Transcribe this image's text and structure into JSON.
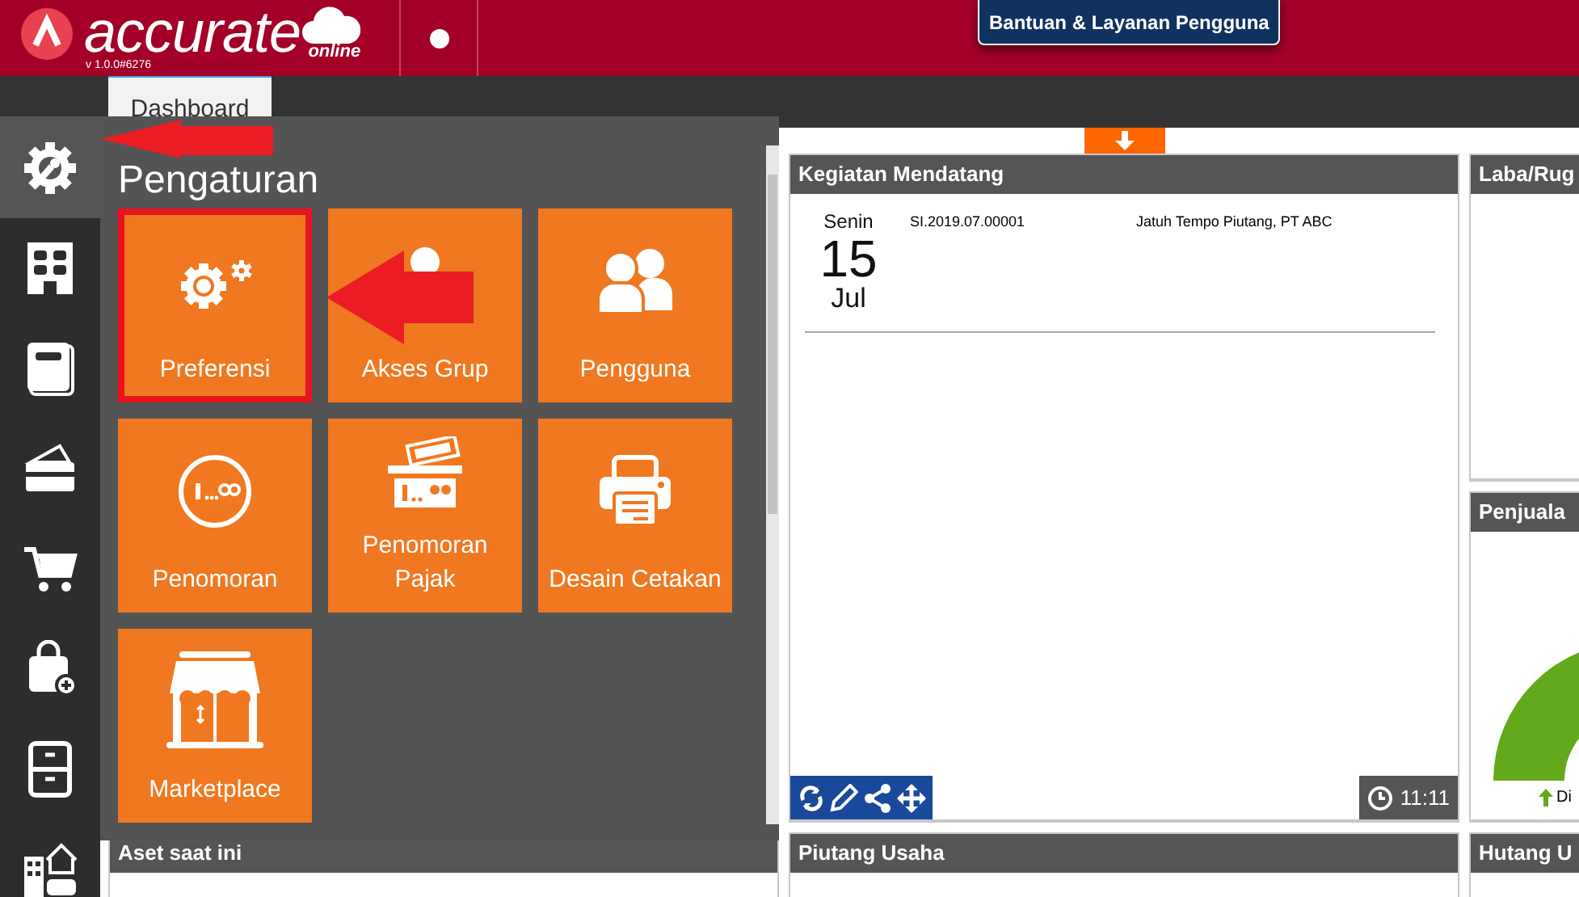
{
  "header": {
    "logo_text": "accurate",
    "logo_suffix": "online",
    "version": "v 1.0.0#6276",
    "help_button": "Bantuan & Layanan Pengguna"
  },
  "tabs": [
    {
      "label": "Dashboard",
      "selected": true
    }
  ],
  "sidebar": {
    "items": [
      {
        "kind": "settings",
        "selected": true
      },
      {
        "kind": "building",
        "selected": false
      },
      {
        "kind": "ledger",
        "selected": false
      },
      {
        "kind": "wallet",
        "selected": false
      },
      {
        "kind": "cart",
        "selected": false
      },
      {
        "kind": "bag",
        "selected": false
      },
      {
        "kind": "cabinet",
        "selected": false
      },
      {
        "kind": "assets",
        "selected": false
      }
    ]
  },
  "menu": {
    "title": "Pengaturan",
    "tiles": [
      {
        "kind": "preferences",
        "label": "Preferensi",
        "selected": true
      },
      {
        "kind": "group",
        "label": "Akses Grup",
        "selected": false
      },
      {
        "kind": "users",
        "label": "Pengguna",
        "selected": false
      },
      {
        "kind": "numbering",
        "label": "Penomoran",
        "selected": false
      },
      {
        "kind": "tax",
        "label": "Penomoran Pajak",
        "selected": false
      },
      {
        "kind": "print",
        "label": "Desain Cetakan",
        "selected": false
      },
      {
        "kind": "market",
        "label": "Marketplace",
        "selected": false
      }
    ]
  },
  "widgets": [
    {
      "kind": "agenda",
      "title": "Kegiatan Mendatang",
      "events": [
        {
          "day": "Senin",
          "date": "15",
          "month": "Jul",
          "number": "SI.2019.07.00001",
          "description": "Jatuh Tempo Piutang, PT ABC"
        }
      ],
      "time": "11:11"
    },
    {
      "kind": "blank",
      "title": "Laba/Rug"
    },
    {
      "kind": "gauge",
      "title": "Penjuala",
      "caption": "Di"
    },
    {
      "kind": "blank",
      "title": "Aset saat ini"
    },
    {
      "kind": "blank",
      "title": "Piutang Usaha"
    },
    {
      "kind": "blank",
      "title": "Hutang U"
    }
  ]
}
